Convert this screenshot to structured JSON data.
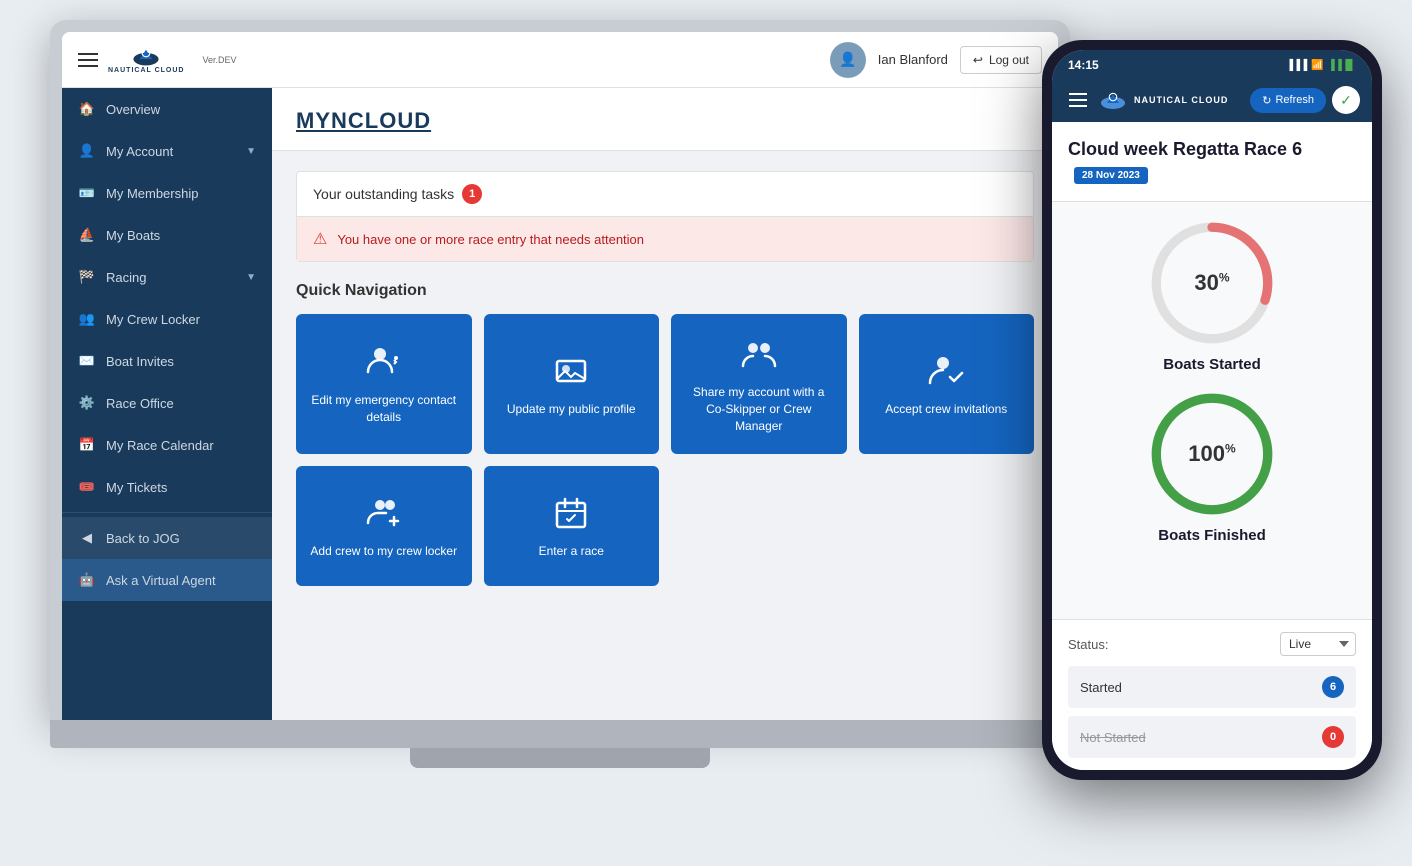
{
  "topbar": {
    "version": "Ver.DEV",
    "logo_text": "NAUTICAL CLOUD",
    "user_name": "Ian Blanford",
    "logout_label": "Log out"
  },
  "sidebar": {
    "items": [
      {
        "id": "overview",
        "label": "Overview",
        "icon": "home",
        "active": false
      },
      {
        "id": "my-account",
        "label": "My Account",
        "icon": "person",
        "has_chevron": true
      },
      {
        "id": "my-membership",
        "label": "My Membership",
        "icon": "card",
        "has_chevron": false
      },
      {
        "id": "my-boats",
        "label": "My Boats",
        "icon": "boat",
        "has_chevron": false
      },
      {
        "id": "racing",
        "label": "Racing",
        "icon": "flag",
        "has_chevron": true
      },
      {
        "id": "my-crew-locker",
        "label": "My Crew Locker",
        "icon": "people",
        "has_chevron": false
      },
      {
        "id": "boat-invites",
        "label": "Boat Invites",
        "icon": "mail",
        "has_chevron": false
      },
      {
        "id": "race-office",
        "label": "Race Office",
        "icon": "gear",
        "has_chevron": false
      },
      {
        "id": "my-race-calendar",
        "label": "My Race Calendar",
        "icon": "calendar",
        "has_chevron": false
      },
      {
        "id": "my-tickets",
        "label": "My Tickets",
        "icon": "ticket",
        "has_chevron": false
      },
      {
        "id": "back-to-jog",
        "label": "Back to JOG",
        "icon": "back",
        "back_item": true
      },
      {
        "id": "ask-virtual-agent",
        "label": "Ask a Virtual Agent",
        "icon": "robot",
        "active": true
      }
    ]
  },
  "main": {
    "title": "MYNCLOUD",
    "tasks_label": "Your outstanding tasks",
    "tasks_count": "1",
    "alert_text": "You have one or more race entry that needs attention",
    "quick_nav_title": "Quick Navigation",
    "quick_nav_cards": [
      {
        "id": "edit-emergency",
        "label": "Edit my emergency contact details",
        "icon": "phone-person"
      },
      {
        "id": "update-profile",
        "label": "Update my public profile",
        "icon": "image-person"
      },
      {
        "id": "share-account",
        "label": "Share my account with a Co-Skipper or Crew Manager",
        "icon": "people-share"
      },
      {
        "id": "accept-crew",
        "label": "Accept crew invitations",
        "icon": "person-check"
      },
      {
        "id": "add-crew",
        "label": "Add crew to my crew locker",
        "icon": "people-add"
      },
      {
        "id": "enter-race",
        "label": "Enter a race",
        "icon": "calendar-edit"
      }
    ]
  },
  "phone": {
    "status_time": "14:15",
    "nav_logo": "NAUTICAL CLOUD",
    "refresh_label": "Refresh",
    "race_title": "Cloud week Regatta Race 6",
    "race_date": "28 Nov 2023",
    "boats_started_pct": 30,
    "boats_started_label": "Boats Started",
    "boats_finished_pct": 100,
    "boats_finished_label": "Boats Finished",
    "status_label": "Status:",
    "status_value": "Live",
    "started_label": "Started",
    "started_count": "6",
    "not_started_label": "Not Started",
    "not_started_count": "0"
  }
}
